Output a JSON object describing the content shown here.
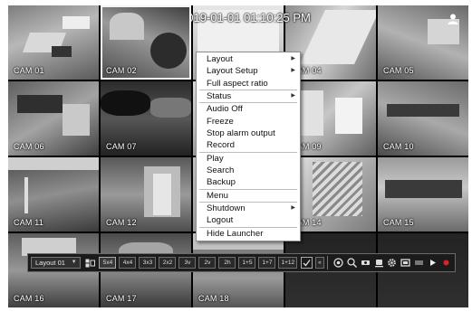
{
  "datetime": "2019-01-01 01:10:25 PM",
  "cameras": [
    {
      "label": "CAM 01"
    },
    {
      "label": "CAM 02"
    },
    {
      "label": ""
    },
    {
      "label": "CAM 04"
    },
    {
      "label": "CAM 05"
    },
    {
      "label": "CAM 06"
    },
    {
      "label": "CAM 07"
    },
    {
      "label": ""
    },
    {
      "label": "CAM 09"
    },
    {
      "label": "CAM 10"
    },
    {
      "label": "CAM 11"
    },
    {
      "label": "CAM 12"
    },
    {
      "label": ""
    },
    {
      "label": "CAM 14"
    },
    {
      "label": "CAM 15"
    },
    {
      "label": "CAM 16"
    },
    {
      "label": "CAM 17"
    },
    {
      "label": "CAM 18"
    },
    {
      "label": ""
    },
    {
      "label": ""
    }
  ],
  "context_menu": {
    "layout": "Layout",
    "layout_setup": "Layout Setup",
    "full_aspect_ratio": "Full aspect ratio",
    "status": "Status",
    "audio_off": "Audio Off",
    "freeze": "Freeze",
    "stop_alarm_output": "Stop alarm output",
    "record": "Record",
    "play": "Play",
    "search": "Search",
    "backup": "Backup",
    "menu": "Menu",
    "shutdown": "Shutdown",
    "logout": "Logout",
    "hide_launcher": "Hide Launcher"
  },
  "launcher": {
    "layout_value": "Layout 01",
    "split_modes": [
      "5x4",
      "4x4",
      "3x3",
      "2x2",
      "3v",
      "2v",
      "2h",
      "1+5",
      "1+7",
      "1+12"
    ],
    "collapse_label": "«"
  },
  "colors": {
    "menu_bg": "#ffffff",
    "launcher_bg": "#1b1b1b",
    "record_dot": "#e02020"
  }
}
